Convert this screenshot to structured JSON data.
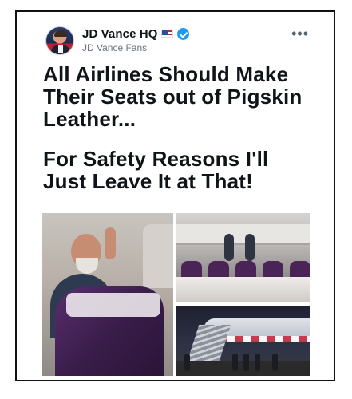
{
  "post": {
    "display_name": "JD Vance HQ",
    "handle": "JD Vance Fans",
    "more_label": "•••",
    "headline_1": "All Airlines Should Make Their Seats out of Pigskin Leather...",
    "headline_2": "For Safety Reasons I'll Just Leave It at That!"
  },
  "icons": {
    "flag": "us-flag-icon",
    "verified": "verified-badge-icon",
    "more": "more-options-icon"
  },
  "colors": {
    "verified_blue": "#1d9bf0",
    "text_primary": "#0f1419",
    "text_secondary": "#6b7280"
  }
}
